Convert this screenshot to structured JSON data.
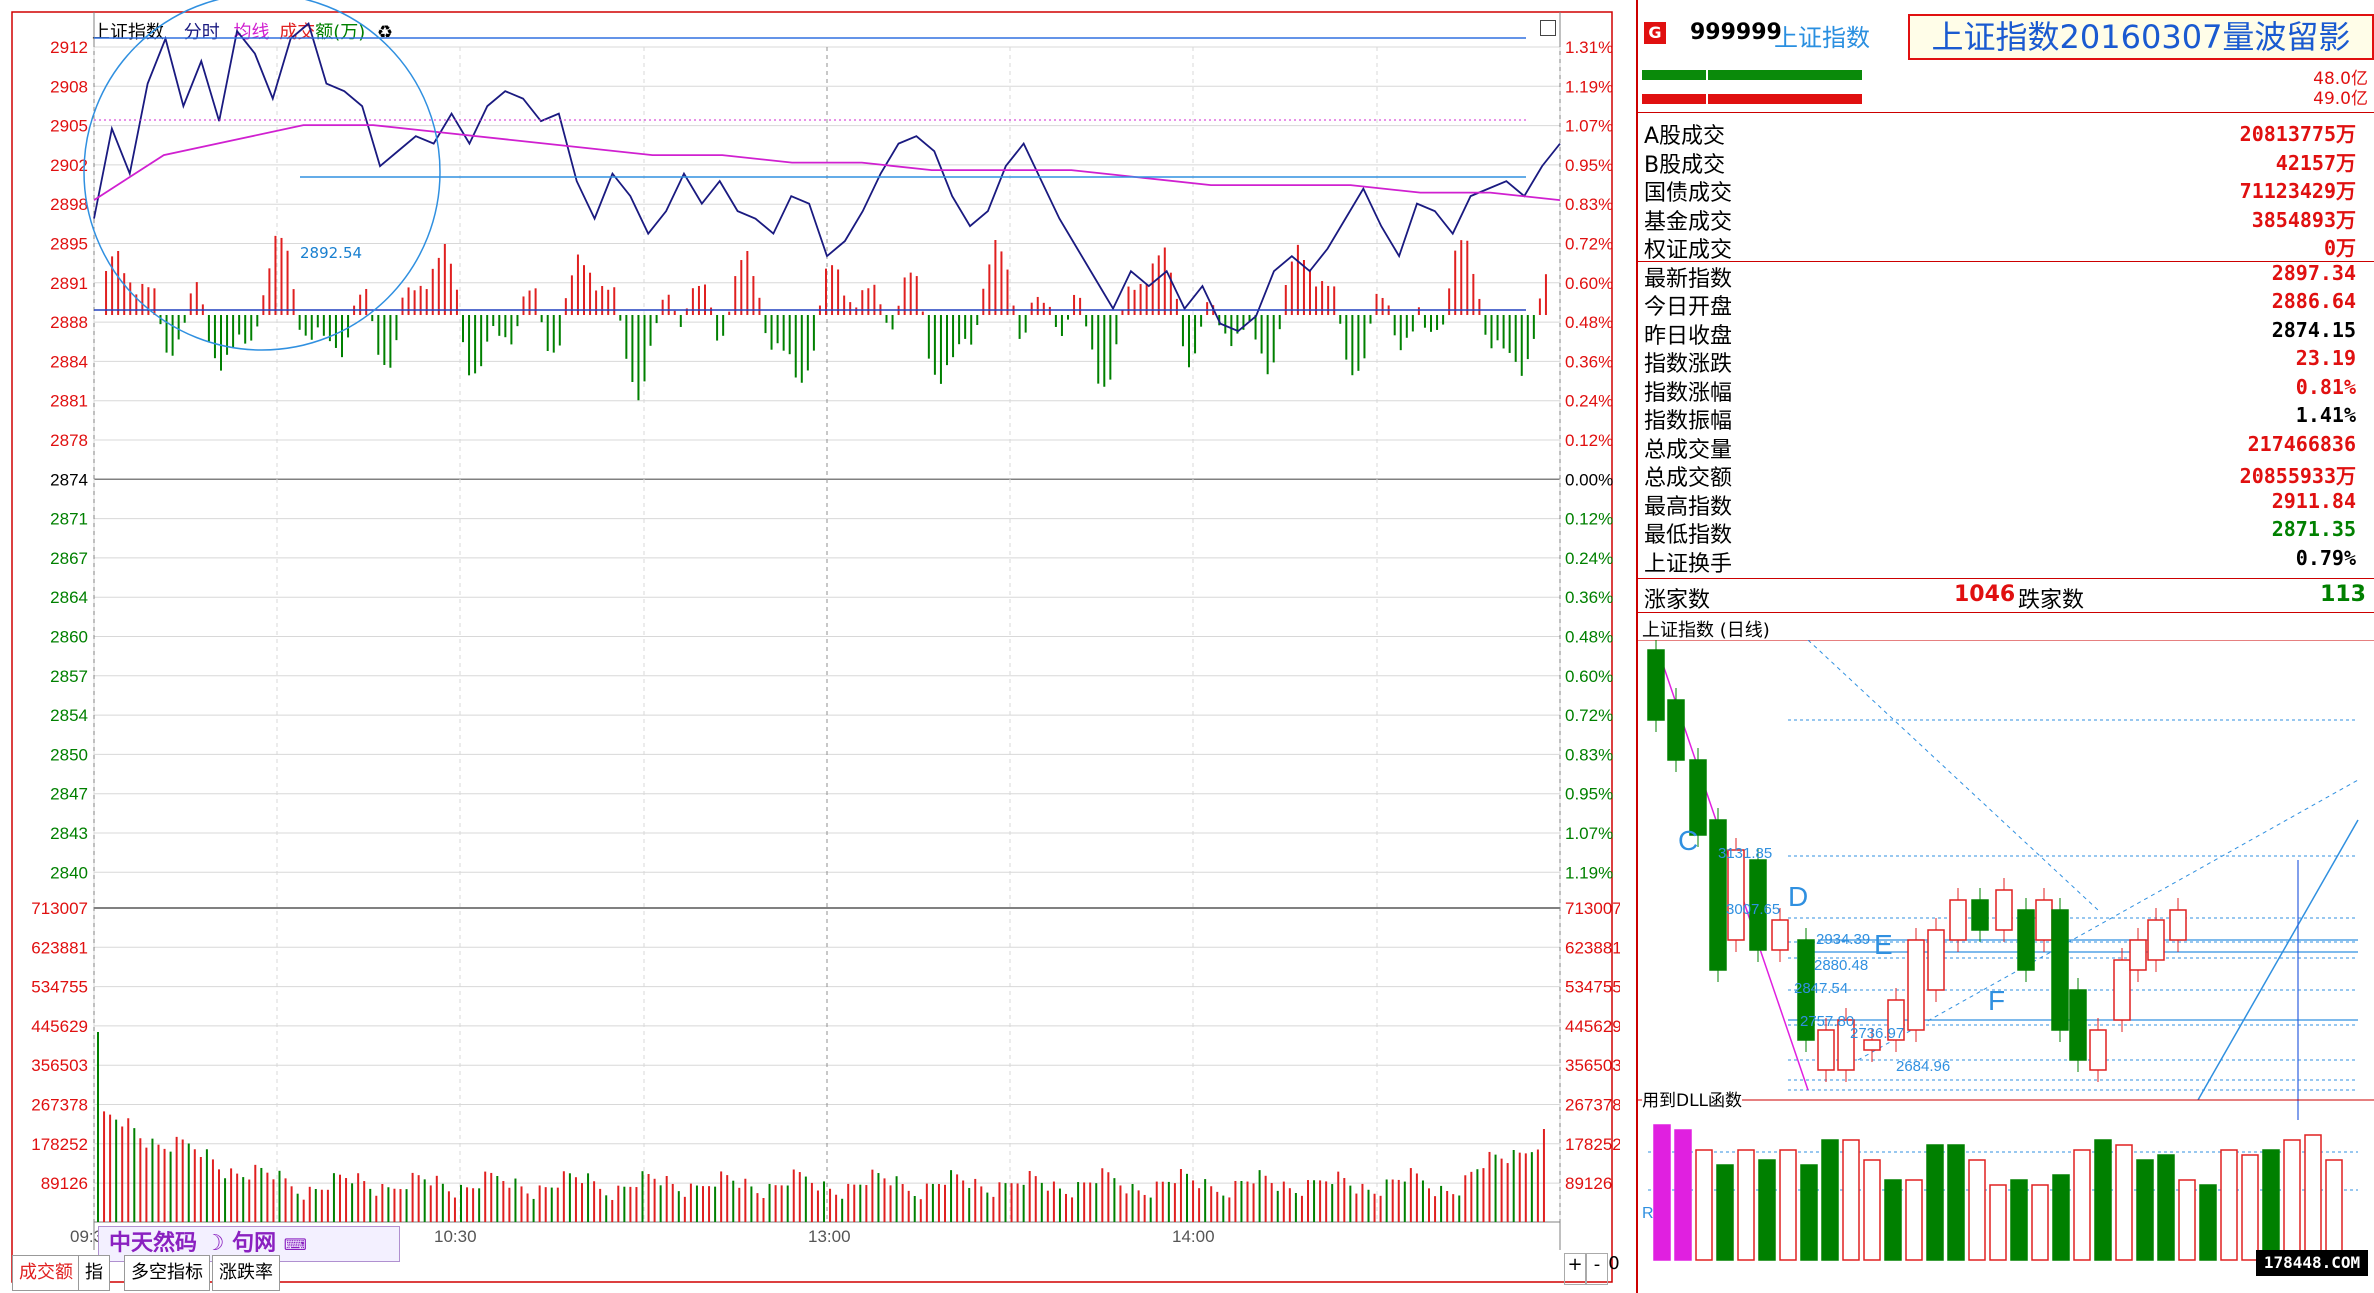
{
  "chart_header": {
    "name": "上证指数",
    "tab_fenshi": "分时",
    "tab_junxian": "均线",
    "tab_chengjiao": "成交",
    "tab_amount": "额(万)",
    "icon": "paint-icon"
  },
  "price_axis": [
    "2912",
    "2908",
    "2905",
    "2902",
    "2898",
    "2895",
    "2891",
    "2888",
    "2884",
    "2881",
    "2878",
    "2874",
    "2871",
    "2867",
    "2864",
    "2860",
    "2857",
    "2854",
    "2850",
    "2847",
    "2843",
    "2840"
  ],
  "pct_axis": [
    "1.31%",
    "1.19%",
    "1.07%",
    "0.95%",
    "0.83%",
    "0.72%",
    "0.60%",
    "0.48%",
    "0.36%",
    "0.24%",
    "0.12%",
    "0.00%",
    "0.12%",
    "0.24%",
    "0.36%",
    "0.48%",
    "0.60%",
    "0.72%",
    "0.83%",
    "0.95%",
    "1.07%",
    "1.19%"
  ],
  "vol_axis": [
    "713007",
    "623881",
    "534755",
    "445629",
    "356503",
    "267378",
    "178252",
    "89126"
  ],
  "time_axis": [
    "09:30",
    "10:30",
    "13:00",
    "14:00"
  ],
  "low_marker": "2892.54",
  "watermark": "中天然码",
  "watermark2": "句网",
  "bottom_tabs": {
    "tab1": "成交额",
    "tab2": "指",
    "tab3": "多空指标",
    "tab4": "涨跌率"
  },
  "zoom_controls": {
    "plus": "+",
    "minus": "-",
    "zero": "0"
  },
  "quote": {
    "badge": "G",
    "code": "999999",
    "name": "上证指数",
    "title": "上证指数20160307量波留影",
    "bar_val1": "48.0亿",
    "bar_val2": "49.0亿"
  },
  "stats": [
    {
      "label": "A股成交",
      "value": "20813775万"
    },
    {
      "label": "B股成交",
      "value": "42157万"
    },
    {
      "label": "国债成交",
      "value": "71123429万"
    },
    {
      "label": "基金成交",
      "value": "3854893万"
    },
    {
      "label": "权证成交",
      "value": "0万"
    },
    {
      "label": "最新指数",
      "value": "2897.34"
    },
    {
      "label": "今日开盘",
      "value": "2886.64"
    },
    {
      "label": "昨日收盘",
      "value": "2874.15"
    },
    {
      "label": "指数涨跌",
      "value": "23.19"
    },
    {
      "label": "指数涨幅",
      "value": "0.81%"
    },
    {
      "label": "指数振幅",
      "value": "1.41%"
    },
    {
      "label": "总成交量",
      "value": "217466836"
    },
    {
      "label": "总成交额",
      "value": "20855933万"
    },
    {
      "label": "最高指数",
      "value": "2911.84"
    },
    {
      "label": "最低指数",
      "value": "2871.35"
    },
    {
      "label": "上证换手",
      "value": "0.79%"
    }
  ],
  "updown": {
    "up_label": "涨家数",
    "up": "1046",
    "down_label": "跌家数",
    "down": "113"
  },
  "daily": {
    "title": "上证指数 (日线)",
    "labels": [
      "C",
      "D",
      "E",
      "F"
    ],
    "prices": [
      "3131.85",
      "3007.65",
      "2934.39",
      "2880.48",
      "2847.54",
      "2757.80",
      "2736.97",
      "2684.96"
    ],
    "dll": "用到DLL函数",
    "r_label": "R"
  },
  "site": "178448.COM",
  "colors": {
    "up": "#e02020",
    "down": "#008000",
    "price_line": "#1a1a80",
    "avg_line": "#d020d0",
    "grid": "#c0c0c0"
  }
}
